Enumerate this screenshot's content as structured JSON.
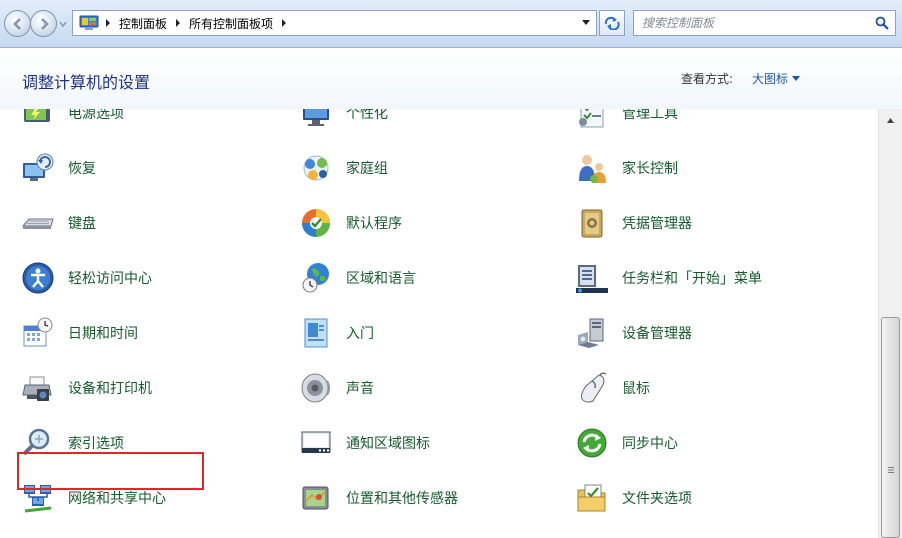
{
  "address_bar": {
    "breadcrumb": [
      "控制面板",
      "所有控制面板项"
    ],
    "search_placeholder": "搜索控制面板"
  },
  "header": {
    "title": "调整计算机的设置",
    "view_by_label": "查看方式:",
    "view_by_value": "大图标"
  },
  "items": [
    {
      "label": "电源选项",
      "icon": "power-options-icon"
    },
    {
      "label": "个性化",
      "icon": "personalization-icon"
    },
    {
      "label": "管理工具",
      "icon": "admin-tools-icon"
    },
    {
      "label": "恢复",
      "icon": "recovery-icon"
    },
    {
      "label": "家庭组",
      "icon": "homegroup-icon"
    },
    {
      "label": "家长控制",
      "icon": "parental-controls-icon"
    },
    {
      "label": "键盘",
      "icon": "keyboard-icon"
    },
    {
      "label": "默认程序",
      "icon": "default-programs-icon"
    },
    {
      "label": "凭据管理器",
      "icon": "credential-manager-icon"
    },
    {
      "label": "轻松访问中心",
      "icon": "ease-of-access-icon"
    },
    {
      "label": "区域和语言",
      "icon": "region-language-icon"
    },
    {
      "label": "任务栏和「开始」菜单",
      "icon": "taskbar-start-menu-icon"
    },
    {
      "label": "日期和时间",
      "icon": "date-time-icon"
    },
    {
      "label": "入门",
      "icon": "getting-started-icon"
    },
    {
      "label": "设备管理器",
      "icon": "device-manager-icon"
    },
    {
      "label": "设备和打印机",
      "icon": "devices-printers-icon"
    },
    {
      "label": "声音",
      "icon": "sound-icon"
    },
    {
      "label": "鼠标",
      "icon": "mouse-icon"
    },
    {
      "label": "索引选项",
      "icon": "indexing-options-icon"
    },
    {
      "label": "通知区域图标",
      "icon": "notification-area-icon"
    },
    {
      "label": "同步中心",
      "icon": "sync-center-icon"
    },
    {
      "label": "网络和共享中心",
      "icon": "network-sharing-icon"
    },
    {
      "label": "位置和其他传感器",
      "icon": "location-sensors-icon"
    },
    {
      "label": "文件夹选项",
      "icon": "folder-options-icon"
    }
  ],
  "highlighted_item": "网络和共享中心",
  "colors": {
    "item_text": "#155b2c",
    "title_text": "#1e3287",
    "link_text": "#1c57a8",
    "highlight_border": "#e0262b"
  }
}
